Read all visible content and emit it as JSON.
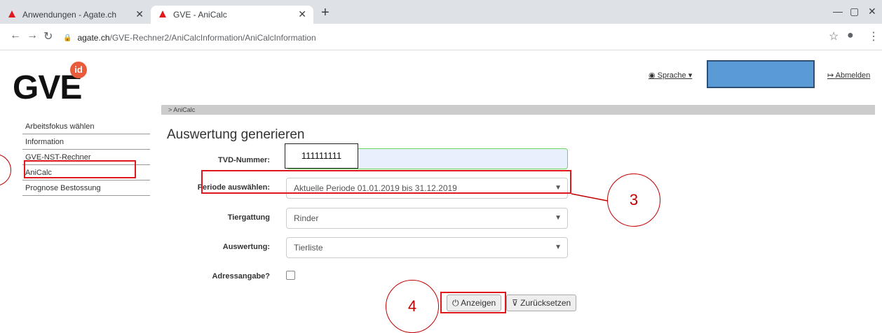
{
  "browser": {
    "tabs": [
      {
        "label": "Anwendungen - Agate.ch"
      },
      {
        "label": "GVE - AniCalc"
      }
    ],
    "url_host": "agate.ch",
    "url_path": "/GVE-Rechner2/AniCalcInformation/AniCalcInformation"
  },
  "header": {
    "logo_text": "GVE",
    "logo_badge": "id",
    "sprache_label": "Sprache ▾",
    "abmelden_label": "Abmelden"
  },
  "breadcrumb": "> AniCalc",
  "sidebar": {
    "items": [
      {
        "label": "Arbeitsfokus wählen"
      },
      {
        "label": "Information"
      },
      {
        "label": "GVE-NST-Rechner"
      },
      {
        "label": "AniCalc"
      },
      {
        "label": "Prognose Bestossung"
      }
    ]
  },
  "form": {
    "title": "Auswertung generieren",
    "tvd_label": "TVD-Nummer:",
    "tvd_value": "111111111",
    "periode_label": "Periode auswählen:",
    "periode_value": "Aktuelle Periode 01.01.2019 bis 31.12.2019",
    "tiergattung_label": "Tiergattung",
    "tiergattung_value": "Rinder",
    "auswertung_label": "Auswertung:",
    "auswertung_value": "Tierliste",
    "adresse_label": "Adressangabe?",
    "anzeigen_label": "Anzeigen",
    "zuruecksetzen_label": "Zurücksetzen"
  },
  "annotations": {
    "step3": "3",
    "step4": "4"
  },
  "colors": {
    "annotation_red": "#e1171e",
    "redacted_blue": "#5b9bd5",
    "logo_badge": "#e95b3b"
  }
}
